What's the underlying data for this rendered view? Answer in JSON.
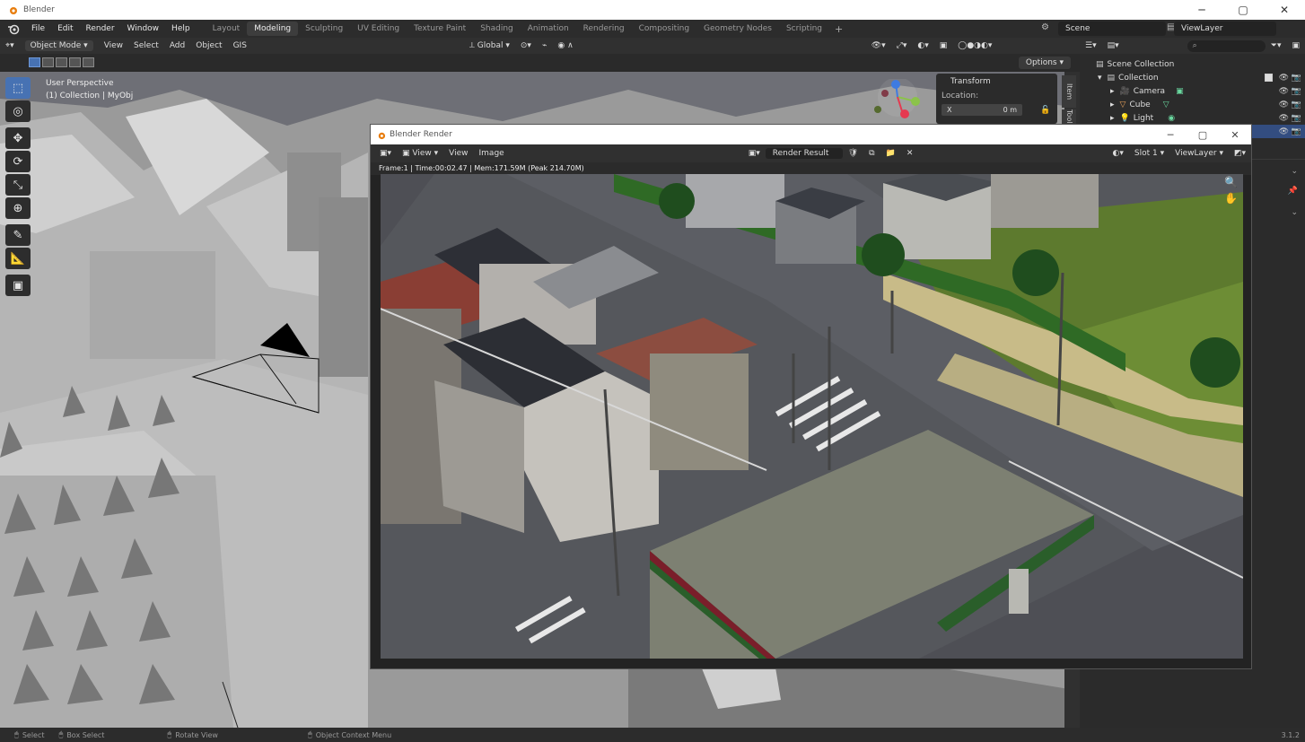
{
  "window": {
    "title": "Blender"
  },
  "menu": [
    "File",
    "Edit",
    "Render",
    "Window",
    "Help"
  ],
  "workspaces": [
    "Layout",
    "Modeling",
    "Sculpting",
    "UV Editing",
    "Texture Paint",
    "Shading",
    "Animation",
    "Rendering",
    "Compositing",
    "Geometry Nodes",
    "Scripting"
  ],
  "workspace_add": "+",
  "scene": "Scene",
  "view_layer": "ViewLayer",
  "viewport_header": {
    "mode": "Object Mode",
    "menus": [
      "View",
      "Select",
      "Add",
      "Object",
      "GIS"
    ],
    "transform_orientation": "Global",
    "options": "Options"
  },
  "viewport": {
    "perspective": "User Perspective",
    "collection_info": "(1) Collection | MyObj"
  },
  "transform_panel": {
    "title": "Transform",
    "location_label": "Location:",
    "x_label": "X",
    "x_value": "0 m",
    "tab_item": "Item",
    "tab_tool": "Tool"
  },
  "outliner": {
    "search_placeholder": "",
    "rows": [
      {
        "label": "Scene Collection"
      },
      {
        "label": "Collection"
      },
      {
        "label": "Camera"
      },
      {
        "label": "Cube"
      },
      {
        "label": "Light"
      }
    ]
  },
  "render_window": {
    "title": "Blender Render",
    "menus": [
      "View",
      "Image"
    ],
    "image_name": "Render Result",
    "slot": "Slot 1",
    "layer": "ViewLayer",
    "info": "Frame:1 | Time:00:02.47 | Mem:171.59M (Peak 214.70M)"
  },
  "status_bar": {
    "select": "Select",
    "box_select": "Box Select",
    "rotate_view": "Rotate View",
    "context_menu": "Object Context Menu",
    "version": "3.1.2"
  },
  "colors": {
    "accent": "#4772b3",
    "selected_row": "#334d80"
  }
}
